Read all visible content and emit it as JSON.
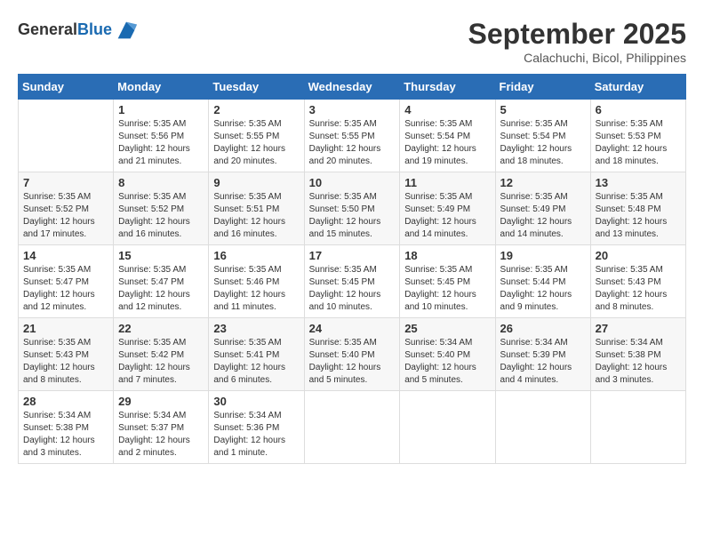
{
  "header": {
    "logo_line1": "General",
    "logo_line2": "Blue",
    "month": "September 2025",
    "location": "Calachuchi, Bicol, Philippines"
  },
  "weekdays": [
    "Sunday",
    "Monday",
    "Tuesday",
    "Wednesday",
    "Thursday",
    "Friday",
    "Saturday"
  ],
  "weeks": [
    [
      {
        "day": "",
        "detail": ""
      },
      {
        "day": "1",
        "detail": "Sunrise: 5:35 AM\nSunset: 5:56 PM\nDaylight: 12 hours\nand 21 minutes."
      },
      {
        "day": "2",
        "detail": "Sunrise: 5:35 AM\nSunset: 5:55 PM\nDaylight: 12 hours\nand 20 minutes."
      },
      {
        "day": "3",
        "detail": "Sunrise: 5:35 AM\nSunset: 5:55 PM\nDaylight: 12 hours\nand 20 minutes."
      },
      {
        "day": "4",
        "detail": "Sunrise: 5:35 AM\nSunset: 5:54 PM\nDaylight: 12 hours\nand 19 minutes."
      },
      {
        "day": "5",
        "detail": "Sunrise: 5:35 AM\nSunset: 5:54 PM\nDaylight: 12 hours\nand 18 minutes."
      },
      {
        "day": "6",
        "detail": "Sunrise: 5:35 AM\nSunset: 5:53 PM\nDaylight: 12 hours\nand 18 minutes."
      }
    ],
    [
      {
        "day": "7",
        "detail": "Sunrise: 5:35 AM\nSunset: 5:52 PM\nDaylight: 12 hours\nand 17 minutes."
      },
      {
        "day": "8",
        "detail": "Sunrise: 5:35 AM\nSunset: 5:52 PM\nDaylight: 12 hours\nand 16 minutes."
      },
      {
        "day": "9",
        "detail": "Sunrise: 5:35 AM\nSunset: 5:51 PM\nDaylight: 12 hours\nand 16 minutes."
      },
      {
        "day": "10",
        "detail": "Sunrise: 5:35 AM\nSunset: 5:50 PM\nDaylight: 12 hours\nand 15 minutes."
      },
      {
        "day": "11",
        "detail": "Sunrise: 5:35 AM\nSunset: 5:49 PM\nDaylight: 12 hours\nand 14 minutes."
      },
      {
        "day": "12",
        "detail": "Sunrise: 5:35 AM\nSunset: 5:49 PM\nDaylight: 12 hours\nand 14 minutes."
      },
      {
        "day": "13",
        "detail": "Sunrise: 5:35 AM\nSunset: 5:48 PM\nDaylight: 12 hours\nand 13 minutes."
      }
    ],
    [
      {
        "day": "14",
        "detail": "Sunrise: 5:35 AM\nSunset: 5:47 PM\nDaylight: 12 hours\nand 12 minutes."
      },
      {
        "day": "15",
        "detail": "Sunrise: 5:35 AM\nSunset: 5:47 PM\nDaylight: 12 hours\nand 12 minutes."
      },
      {
        "day": "16",
        "detail": "Sunrise: 5:35 AM\nSunset: 5:46 PM\nDaylight: 12 hours\nand 11 minutes."
      },
      {
        "day": "17",
        "detail": "Sunrise: 5:35 AM\nSunset: 5:45 PM\nDaylight: 12 hours\nand 10 minutes."
      },
      {
        "day": "18",
        "detail": "Sunrise: 5:35 AM\nSunset: 5:45 PM\nDaylight: 12 hours\nand 10 minutes."
      },
      {
        "day": "19",
        "detail": "Sunrise: 5:35 AM\nSunset: 5:44 PM\nDaylight: 12 hours\nand 9 minutes."
      },
      {
        "day": "20",
        "detail": "Sunrise: 5:35 AM\nSunset: 5:43 PM\nDaylight: 12 hours\nand 8 minutes."
      }
    ],
    [
      {
        "day": "21",
        "detail": "Sunrise: 5:35 AM\nSunset: 5:43 PM\nDaylight: 12 hours\nand 8 minutes."
      },
      {
        "day": "22",
        "detail": "Sunrise: 5:35 AM\nSunset: 5:42 PM\nDaylight: 12 hours\nand 7 minutes."
      },
      {
        "day": "23",
        "detail": "Sunrise: 5:35 AM\nSunset: 5:41 PM\nDaylight: 12 hours\nand 6 minutes."
      },
      {
        "day": "24",
        "detail": "Sunrise: 5:35 AM\nSunset: 5:40 PM\nDaylight: 12 hours\nand 5 minutes."
      },
      {
        "day": "25",
        "detail": "Sunrise: 5:34 AM\nSunset: 5:40 PM\nDaylight: 12 hours\nand 5 minutes."
      },
      {
        "day": "26",
        "detail": "Sunrise: 5:34 AM\nSunset: 5:39 PM\nDaylight: 12 hours\nand 4 minutes."
      },
      {
        "day": "27",
        "detail": "Sunrise: 5:34 AM\nSunset: 5:38 PM\nDaylight: 12 hours\nand 3 minutes."
      }
    ],
    [
      {
        "day": "28",
        "detail": "Sunrise: 5:34 AM\nSunset: 5:38 PM\nDaylight: 12 hours\nand 3 minutes."
      },
      {
        "day": "29",
        "detail": "Sunrise: 5:34 AM\nSunset: 5:37 PM\nDaylight: 12 hours\nand 2 minutes."
      },
      {
        "day": "30",
        "detail": "Sunrise: 5:34 AM\nSunset: 5:36 PM\nDaylight: 12 hours\nand 1 minute."
      },
      {
        "day": "",
        "detail": ""
      },
      {
        "day": "",
        "detail": ""
      },
      {
        "day": "",
        "detail": ""
      },
      {
        "day": "",
        "detail": ""
      }
    ]
  ]
}
